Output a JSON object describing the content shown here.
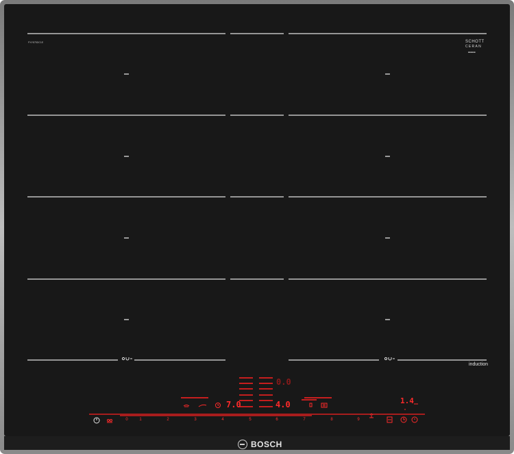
{
  "brand": {
    "name": "BOSCH",
    "logo_icon": "bosch-armature-logo"
  },
  "glass": {
    "line1": "SCHOTT",
    "line2": "CERAN",
    "small": "■■■■■■",
    "model": "PXY875DC1E"
  },
  "label": {
    "induction": "induction"
  },
  "displays": {
    "top": "0.0",
    "left": "7.0",
    "right": "4.0",
    "timer": "1.4"
  },
  "slider": {
    "scale": [
      "0",
      "1",
      "2",
      "3",
      "4",
      "5",
      "6",
      "7",
      "8",
      "9"
    ]
  },
  "colors": {
    "glass": "#181818",
    "frame": "#9a9a9a",
    "lines": "#e0e0e0",
    "display_red": "#ff2a2a"
  },
  "icons": [
    "power-icon",
    "child-lock-icon",
    "flex-zone-icon",
    "pan-icon",
    "frying-sensor-icon",
    "timer-icon",
    "move-icon",
    "boost-icon",
    "hob-settings-icon",
    "clock-icon"
  ]
}
